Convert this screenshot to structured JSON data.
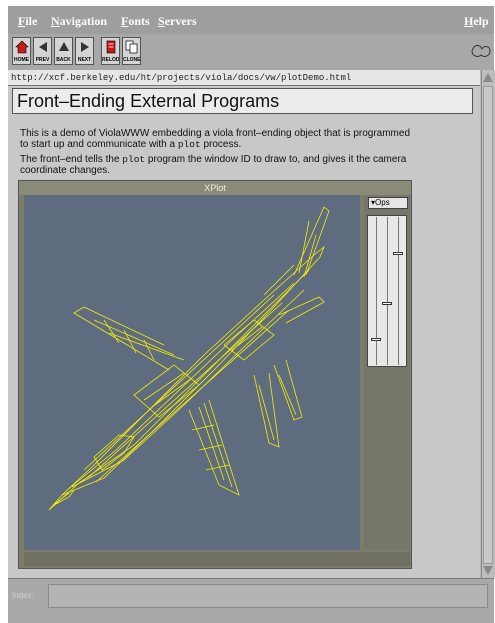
{
  "menu": {
    "file": "File",
    "navigation": "Navigation",
    "fonts": "Fonts",
    "servers": "Servers",
    "help": "Help"
  },
  "toolbar": {
    "home": "HOME",
    "prev": "PREV",
    "back": "BACK",
    "next": "NEXT",
    "reload": "RELOD",
    "clone": "CLONE"
  },
  "url": "http://xcf.berkeley.edu/ht/projects/viola/docs/vw/plotDemo.html",
  "page": {
    "title": "Front–Ending External Programs",
    "para1_a": "This is a demo of ViolaWWW embedding a viola front–ending object that is programmed",
    "para1_b": "to start up and communicate with a ",
    "para1_code": "plot",
    "para1_c": " process.",
    "para2_a": "The front–end tells the ",
    "para2_code": "plot",
    "para2_b": " program the window ID to draw to, and gives it the camera",
    "para2_c": "coordinate changes."
  },
  "xplot": {
    "title": "XPlot",
    "dropdown": "Ops",
    "sliders": [
      {
        "level": 0.15
      },
      {
        "level": 0.4
      },
      {
        "level": 0.75
      }
    ]
  },
  "status": {
    "label": "Index:",
    "value": ""
  },
  "colors": {
    "wireframe": "#f5f000",
    "plot_bg": "#5f6b7e"
  }
}
